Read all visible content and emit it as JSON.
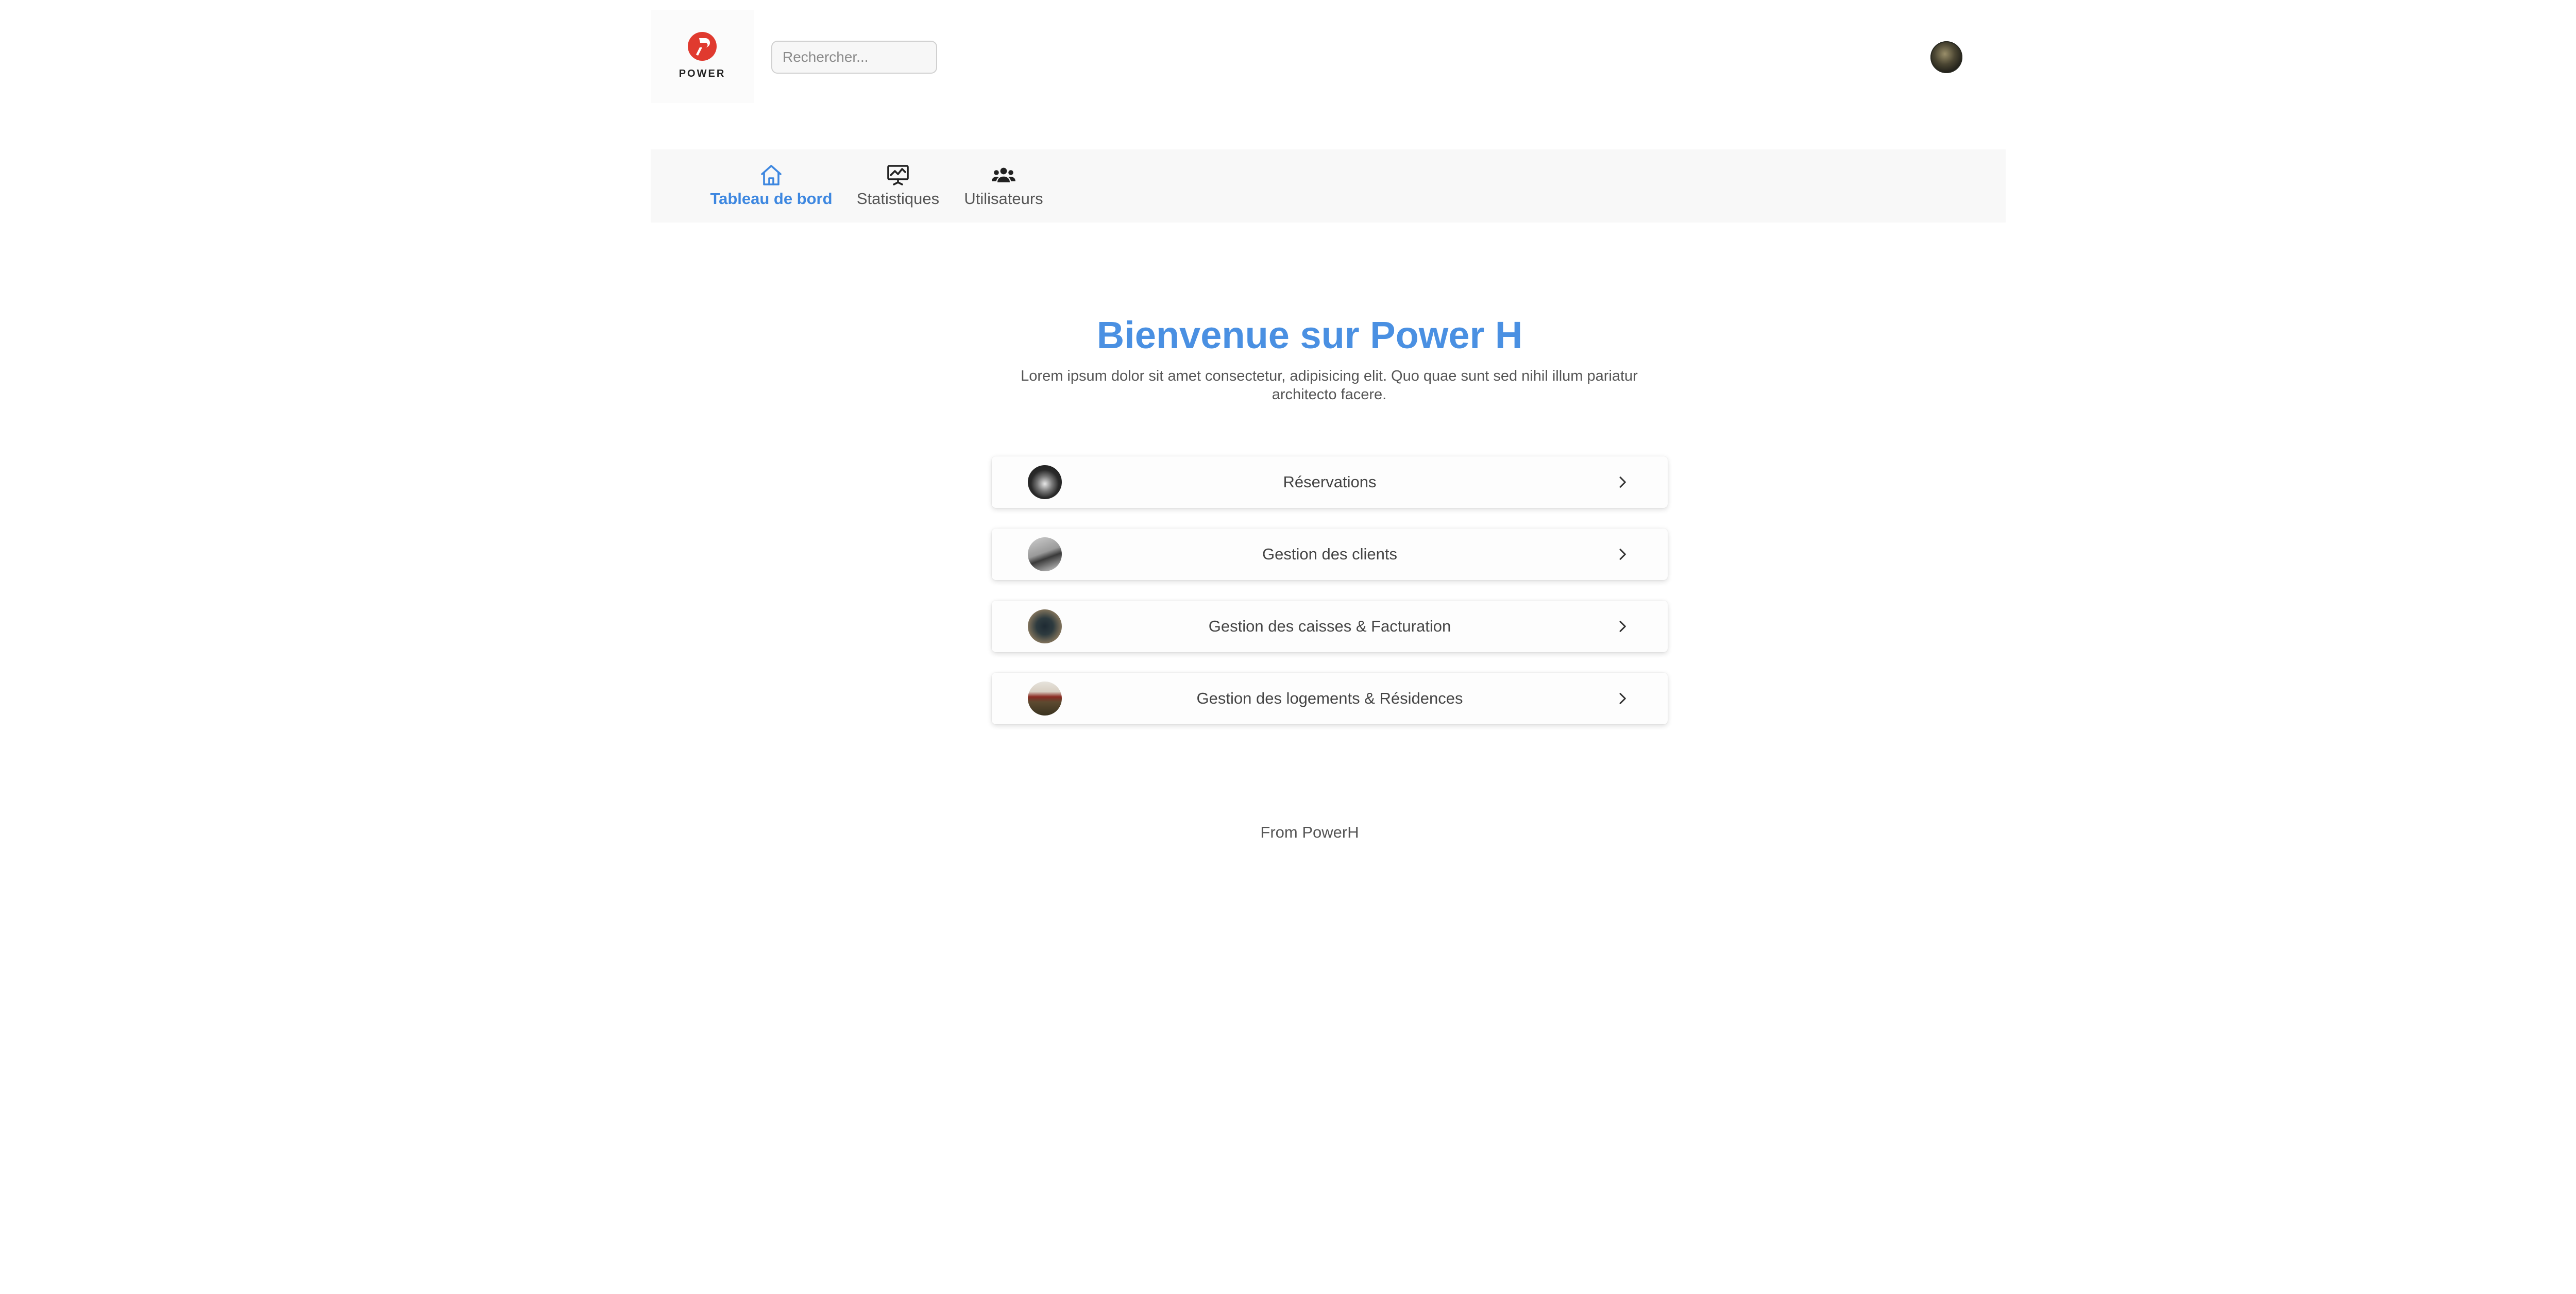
{
  "header": {
    "logo_text": "POWER",
    "brand_color": "#e03a2f",
    "search": {
      "placeholder": "Rechercher...",
      "value": ""
    },
    "avatar_icon": "user-avatar"
  },
  "nav": {
    "items": [
      {
        "label": "Tableau de bord",
        "icon": "home-icon",
        "active": true
      },
      {
        "label": "Statistiques",
        "icon": "chart-board-icon",
        "active": false
      },
      {
        "label": "Utilisateurs",
        "icon": "users-icon",
        "active": false
      }
    ],
    "active_color": "#3d87e0"
  },
  "main": {
    "title": "Bienvenue sur Power H",
    "title_color": "#4a90e2",
    "subtitle": "Lorem ipsum dolor sit amet consectetur, adipisicing elit. Quo quae sunt sed nihil illum pariatur architecto facere.",
    "cards": [
      {
        "label": "Réservations",
        "icon": "chevron-right-icon"
      },
      {
        "label": "Gestion des clients",
        "icon": "chevron-right-icon"
      },
      {
        "label": "Gestion des caisses & Facturation",
        "icon": "chevron-right-icon"
      },
      {
        "label": "Gestion des logements & Résidences",
        "icon": "chevron-right-icon"
      }
    ]
  },
  "footer": {
    "text": "From PowerH"
  }
}
